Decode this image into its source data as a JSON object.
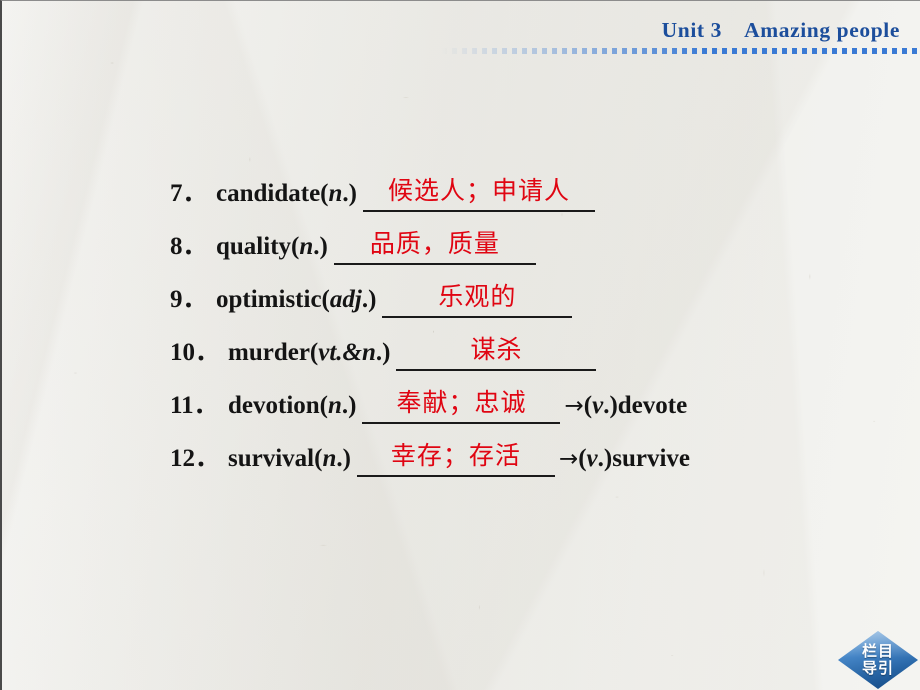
{
  "header": {
    "unit_title": "Unit 3　Amazing people",
    "title_color": "#1c4e9c",
    "rule_color": "#3a7ad4"
  },
  "colors": {
    "gloss_red": "#e00512",
    "text_black": "#141414",
    "badge_blue": "#2163a8",
    "paper": "#f3f3f0"
  },
  "vocab": {
    "rows": [
      {
        "index": "7．",
        "term": "candidate(",
        "pos": "n",
        "term_close": ".)",
        "gloss": "候选人；申请人",
        "blank_width": 232,
        "derived_arrow": "",
        "derived_pos": "",
        "derived_word": ""
      },
      {
        "index": "8．",
        "term": "quality(",
        "pos": "n",
        "term_close": ".)",
        "gloss": "品质，质量",
        "blank_width": 202,
        "derived_arrow": "",
        "derived_pos": "",
        "derived_word": ""
      },
      {
        "index": "9．",
        "term": "optimistic(",
        "pos": "adj",
        "term_close": ".)",
        "gloss": "乐观的",
        "blank_width": 190,
        "derived_arrow": "",
        "derived_pos": "",
        "derived_word": ""
      },
      {
        "index": "10．",
        "term": "murder(",
        "pos": "vt.&n",
        "term_close": ".)",
        "gloss": "谋杀",
        "blank_width": 200,
        "derived_arrow": "",
        "derived_pos": "",
        "derived_word": ""
      },
      {
        "index": "11．",
        "term": "devotion(",
        "pos": "n",
        "term_close": ".)",
        "gloss": "奉献；忠诚",
        "blank_width": 198,
        "derived_arrow": "→",
        "derived_pos": "v",
        "derived_word": ".)devote"
      },
      {
        "index": "12．",
        "term": "survival(",
        "pos": "n",
        "term_close": ".)",
        "gloss": "幸存；存活",
        "blank_width": 198,
        "derived_arrow": "→",
        "derived_pos": "v",
        "derived_word": ".)survive"
      }
    ]
  },
  "nav_badge": {
    "line1": "栏目",
    "line2": "导引"
  }
}
